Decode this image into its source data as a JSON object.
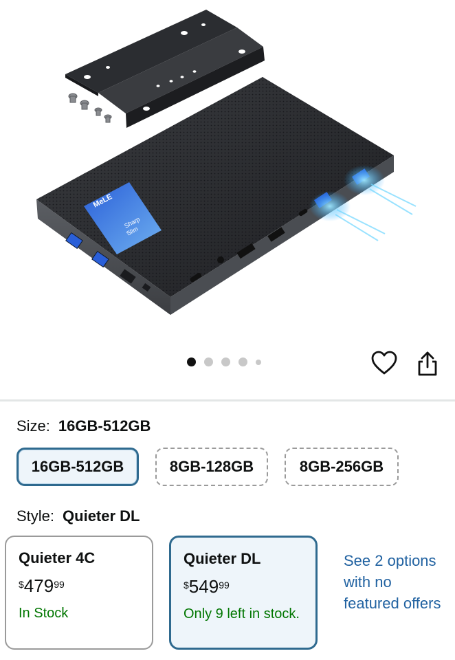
{
  "product_image": {
    "brand_label": "MeLE",
    "sticker_text": "Sharp & Slim Mini PC"
  },
  "gallery": {
    "total": 5,
    "active_index": 0
  },
  "actions": {
    "icons": [
      "heart-icon",
      "share-icon"
    ]
  },
  "size": {
    "label": "Size:",
    "selected": "16GB-512GB",
    "options": [
      "16GB-512GB",
      "8GB-128GB",
      "8GB-256GB"
    ]
  },
  "style": {
    "label": "Style:",
    "selected": "Quieter DL",
    "options": [
      {
        "name": "Quieter 4C",
        "currency": "$",
        "whole": "479",
        "fraction": "99",
        "stock": "In Stock"
      },
      {
        "name": "Quieter DL",
        "currency": "$",
        "whole": "549",
        "fraction": "99",
        "stock": "Only 9 left in stock."
      }
    ],
    "see_more": "See 2 options with no featured offers"
  },
  "colors": {
    "link": "#2162a1",
    "stock": "#007600",
    "selected_border": "#2f6a8f"
  }
}
